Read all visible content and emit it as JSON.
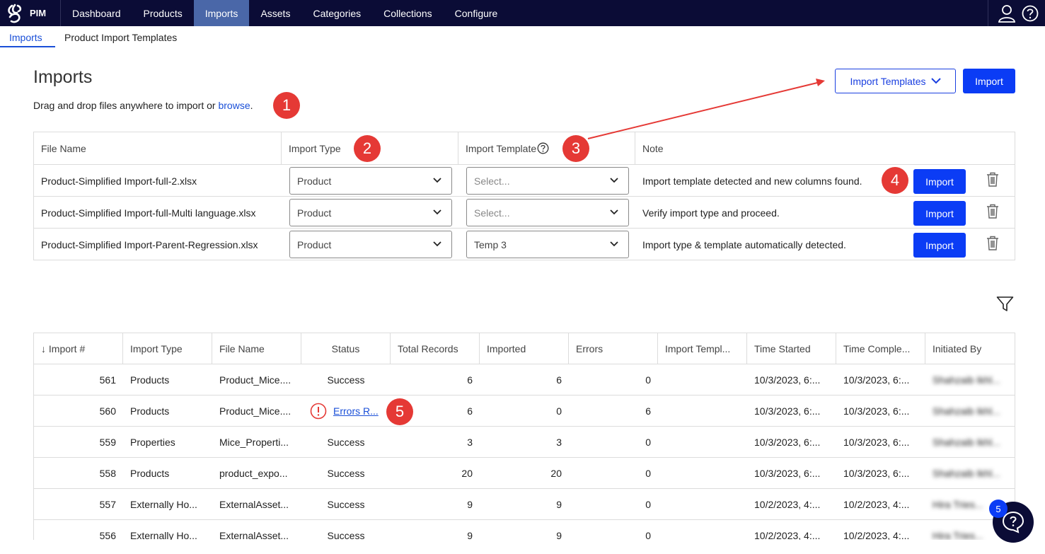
{
  "app": {
    "name": "PIM"
  },
  "nav": [
    "Dashboard",
    "Products",
    "Imports",
    "Assets",
    "Categories",
    "Collections",
    "Configure"
  ],
  "subtabs": [
    "Imports",
    "Product Import Templates"
  ],
  "page": {
    "title": "Imports",
    "drag_text": "Drag and drop files anywhere to import or ",
    "browse": "browse",
    "drag_end": ".",
    "import_templates_btn": "Import Templates",
    "import_btn": "Import"
  },
  "upload_table": {
    "headers": [
      "File Name",
      "Import Type",
      "Import Template",
      "Note"
    ],
    "rows": [
      {
        "file": "Product-Simplified Import-full-2.xlsx",
        "type": "Product",
        "template": "Select...",
        "note": "Import template detected and new columns found.",
        "action": "Import"
      },
      {
        "file": "Product-Simplified Import-full-Multi language.xlsx",
        "type": "Product",
        "template": "Select...",
        "note": "Verify import type and proceed.",
        "action": "Import"
      },
      {
        "file": "Product-Simplified Import-Parent-Regression.xlsx",
        "type": "Product",
        "template": "Temp 3",
        "note": "Import type & template automatically detected.",
        "action": "Import"
      }
    ]
  },
  "markers": [
    "1",
    "2",
    "3",
    "4",
    "5"
  ],
  "history_table": {
    "headers": [
      "↓ Import #",
      "Import Type",
      "File Name",
      "Status",
      "Total Records",
      "Imported",
      "Errors",
      "Import Templ...",
      "Time Started",
      "Time Comple...",
      "Initiated By"
    ],
    "rows": [
      {
        "num": "561",
        "type": "Products",
        "file": "Product_Mice....",
        "status": "Success",
        "total": "6",
        "imported": "6",
        "errors": "0",
        "template": "",
        "started": "10/3/2023, 6:...",
        "completed": "10/3/2023, 6:...",
        "by": "Shahzaib Ikhl..."
      },
      {
        "num": "560",
        "type": "Products",
        "file": "Product_Mice....",
        "status": "Errors R...",
        "total": "6",
        "imported": "0",
        "errors": "6",
        "template": "",
        "started": "10/3/2023, 6:...",
        "completed": "10/3/2023, 6:...",
        "by": "Shahzaib Ikhl..."
      },
      {
        "num": "559",
        "type": "Properties",
        "file": "Mice_Properti...",
        "status": "Success",
        "total": "3",
        "imported": "3",
        "errors": "0",
        "template": "",
        "started": "10/3/2023, 6:...",
        "completed": "10/3/2023, 6:...",
        "by": "Shahzaib Ikhl..."
      },
      {
        "num": "558",
        "type": "Products",
        "file": "product_expo...",
        "status": "Success",
        "total": "20",
        "imported": "20",
        "errors": "0",
        "template": "",
        "started": "10/3/2023, 6:...",
        "completed": "10/3/2023, 6:...",
        "by": "Shahzaib Ikhl..."
      },
      {
        "num": "557",
        "type": "Externally Ho...",
        "file": "ExternalAsset...",
        "status": "Success",
        "total": "9",
        "imported": "9",
        "errors": "0",
        "template": "",
        "started": "10/2/2023, 4:...",
        "completed": "10/2/2023, 4:...",
        "by": "Hira Tries..."
      },
      {
        "num": "556",
        "type": "Externally Ho...",
        "file": "ExternalAsset...",
        "status": "Success",
        "total": "9",
        "imported": "9",
        "errors": "0",
        "template": "",
        "started": "10/2/2023, 4:...",
        "completed": "10/2/2023, 4:...",
        "by": "Hira Tries..."
      }
    ]
  },
  "help": {
    "badge": "5"
  },
  "colors": {
    "nav_bg": "#0b0c36",
    "primary": "#0b3cf5",
    "marker": "#e53935"
  }
}
